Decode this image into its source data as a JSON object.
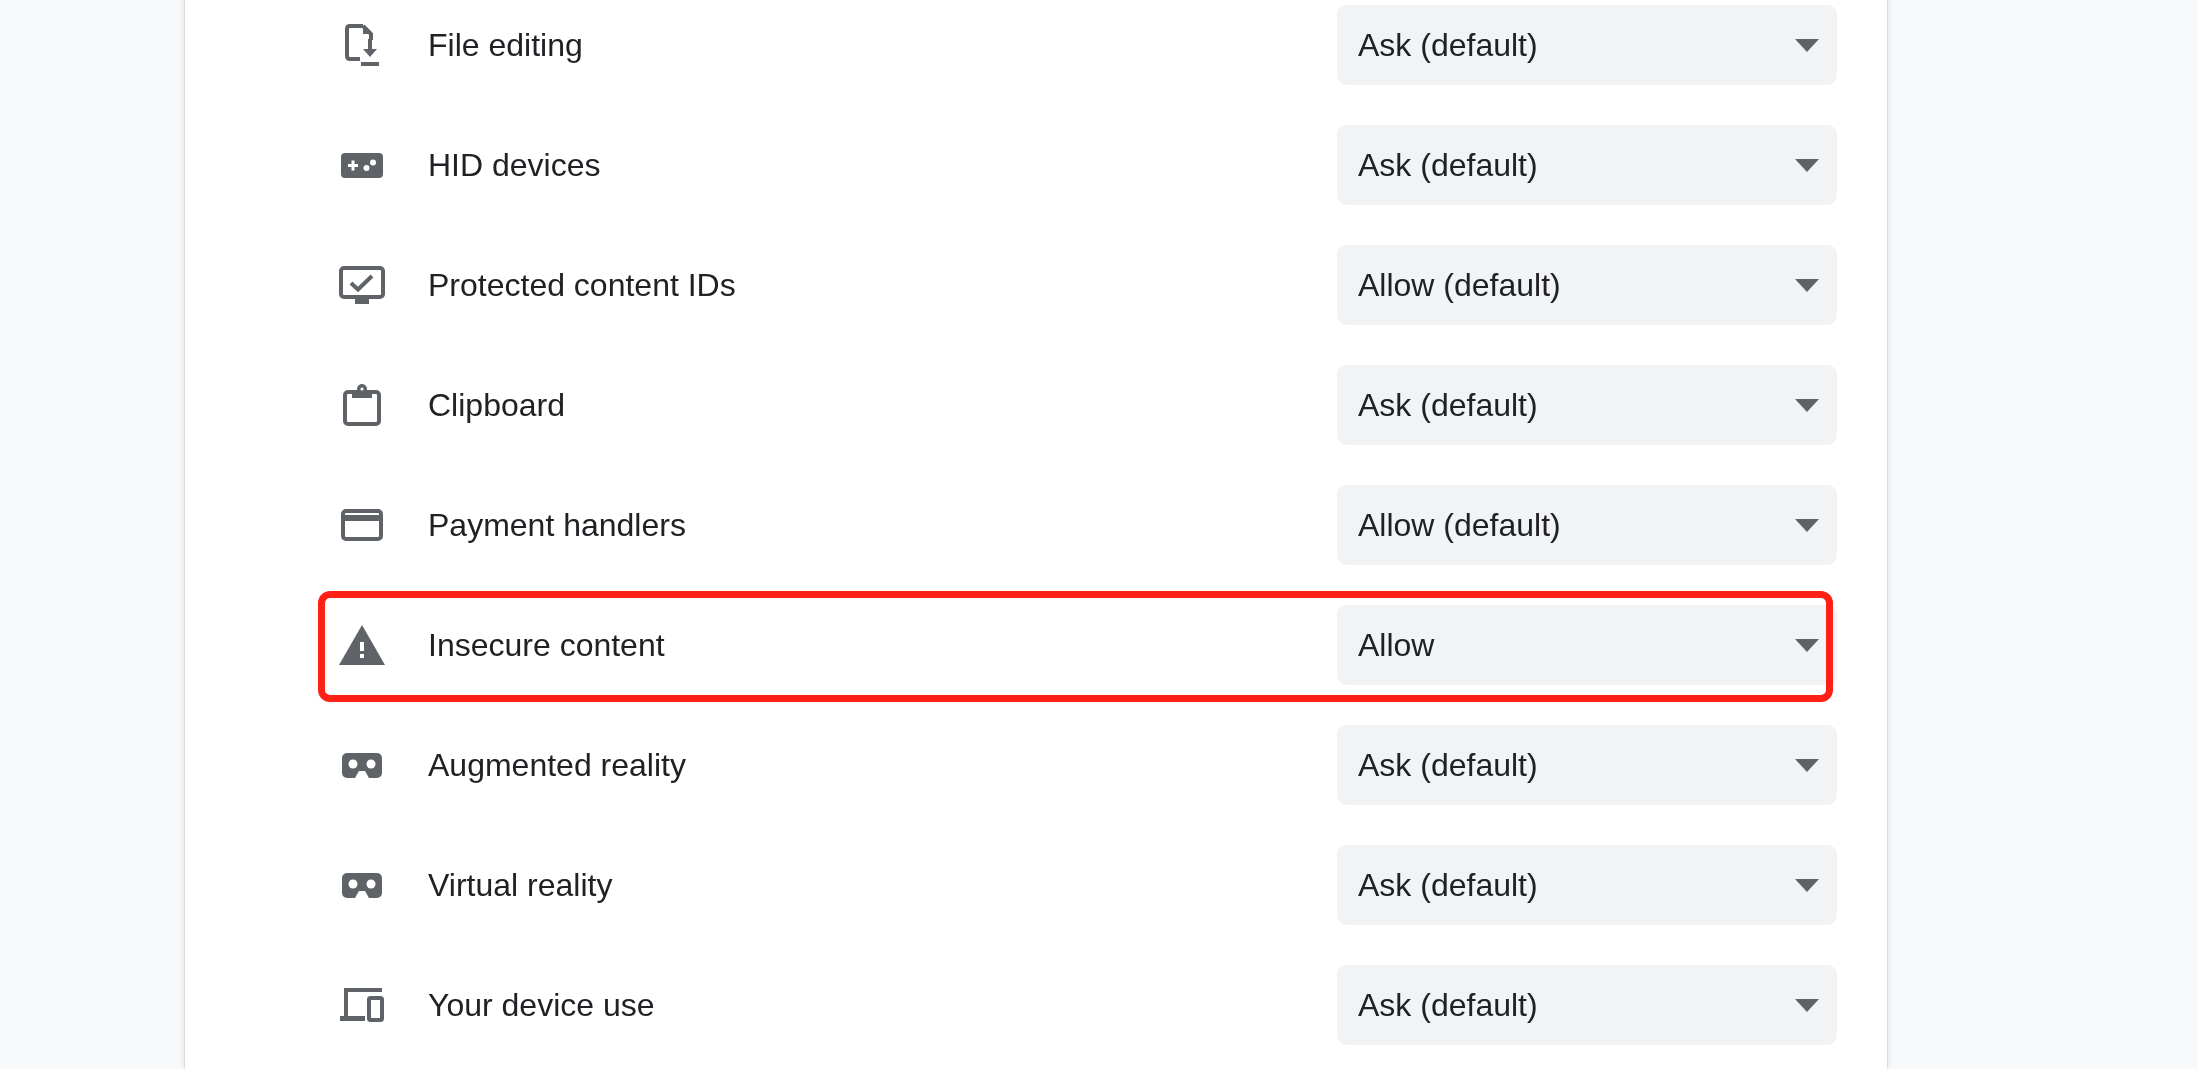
{
  "rows": [
    {
      "label": "File editing",
      "value": "Ask (default)",
      "highlighted": false
    },
    {
      "label": "HID devices",
      "value": "Ask (default)",
      "highlighted": false
    },
    {
      "label": "Protected content IDs",
      "value": "Allow (default)",
      "highlighted": false
    },
    {
      "label": "Clipboard",
      "value": "Ask (default)",
      "highlighted": false
    },
    {
      "label": "Payment handlers",
      "value": "Allow (default)",
      "highlighted": false
    },
    {
      "label": "Insecure content",
      "value": "Allow",
      "highlighted": true
    },
    {
      "label": "Augmented reality",
      "value": "Ask (default)",
      "highlighted": false
    },
    {
      "label": "Virtual reality",
      "value": "Ask (default)",
      "highlighted": false
    },
    {
      "label": "Your device use",
      "value": "Ask (default)",
      "highlighted": false
    }
  ]
}
